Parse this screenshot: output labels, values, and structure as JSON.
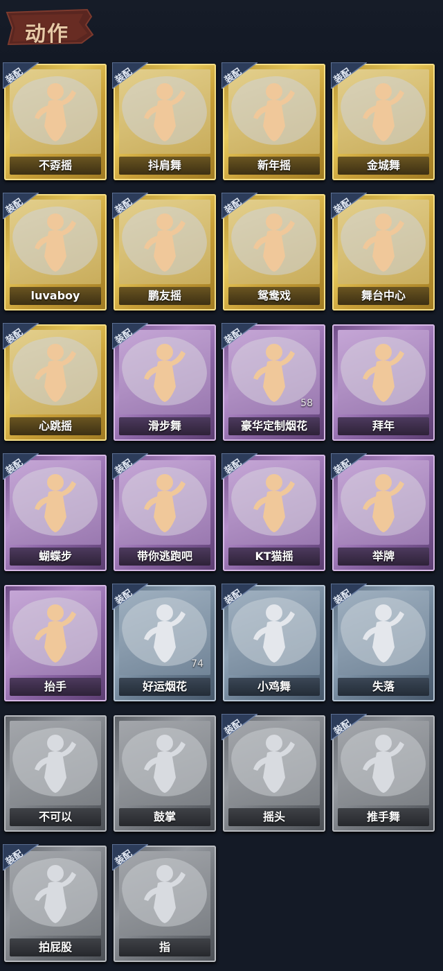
{
  "header": {
    "title": "动作"
  },
  "badge_label": "装配",
  "colors": {
    "gold": "#d9b94c",
    "purple": "#a27bbb",
    "blue": "#7f93a7",
    "grey": "#8a8e93",
    "background": "#141a26"
  },
  "emotes": [
    {
      "name": "不孬摇",
      "tier": "gold",
      "equipped": true,
      "icon": "dancer-arm-raised-icon"
    },
    {
      "name": "抖肩舞",
      "tier": "gold",
      "equipped": true,
      "icon": "dancer-shoulder-shake-icon"
    },
    {
      "name": "新年摇",
      "tier": "gold",
      "equipped": true,
      "icon": "dancer-new-year-icon"
    },
    {
      "name": "金城舞",
      "tier": "gold",
      "equipped": true,
      "icon": "dancer-wave-icon"
    },
    {
      "name": "luvaboy",
      "tier": "gold",
      "equipped": true,
      "icon": "dancer-cross-arms-icon"
    },
    {
      "name": "鹏友摇",
      "tier": "gold",
      "equipped": true,
      "icon": "dancer-point-icon"
    },
    {
      "name": "鸳鸯戏",
      "tier": "gold",
      "equipped": true,
      "icon": "dancer-music-icon"
    },
    {
      "name": "舞台中心",
      "tier": "gold",
      "equipped": true,
      "icon": "dancer-stage-icon"
    },
    {
      "name": "心跳摇",
      "tier": "gold",
      "equipped": true,
      "icon": "dancer-heartbeat-icon"
    },
    {
      "name": "滑步舞",
      "tier": "purple",
      "equipped": true,
      "icon": "dancer-slide-icon"
    },
    {
      "name": "豪华定制烟花",
      "tier": "purple",
      "equipped": true,
      "icon": "fireworks-box-icon",
      "count": "58"
    },
    {
      "name": "拜年",
      "tier": "purple",
      "equipped": false,
      "icon": "figure-greeting-icon"
    },
    {
      "name": "蝴蝶步",
      "tier": "purple",
      "equipped": true,
      "icon": "dancer-butterfly-icon"
    },
    {
      "name": "带你逃跑吧",
      "tier": "purple",
      "equipped": true,
      "icon": "dancer-run-icon"
    },
    {
      "name": "KT猫摇",
      "tier": "purple",
      "equipped": true,
      "icon": "dancer-cat-icon"
    },
    {
      "name": "举牌",
      "tier": "purple",
      "equipped": true,
      "icon": "figure-sign-icon"
    },
    {
      "name": "抬手",
      "tier": "purple",
      "equipped": false,
      "icon": "figure-raise-hand-icon"
    },
    {
      "name": "好运烟花",
      "tier": "blue",
      "equipped": true,
      "icon": "firework-can-icon",
      "count": "74"
    },
    {
      "name": "小鸡舞",
      "tier": "blue",
      "equipped": true,
      "icon": "figure-chicken-dance-icon"
    },
    {
      "name": "失落",
      "tier": "blue",
      "equipped": true,
      "icon": "figure-kneel-icon"
    },
    {
      "name": "不可以",
      "tier": "grey",
      "equipped": false,
      "icon": "finger-wag-icon"
    },
    {
      "name": "鼓掌",
      "tier": "grey",
      "equipped": false,
      "icon": "clap-hands-icon"
    },
    {
      "name": "摇头",
      "tier": "grey",
      "equipped": true,
      "icon": "figure-head-shake-icon"
    },
    {
      "name": "推手舞",
      "tier": "grey",
      "equipped": true,
      "icon": "figure-push-icon"
    },
    {
      "name": "拍屁股",
      "tier": "grey",
      "equipped": true,
      "icon": "figure-slap-icon"
    },
    {
      "name": "指",
      "tier": "grey",
      "equipped": true,
      "icon": "pointing-hand-icon"
    }
  ]
}
